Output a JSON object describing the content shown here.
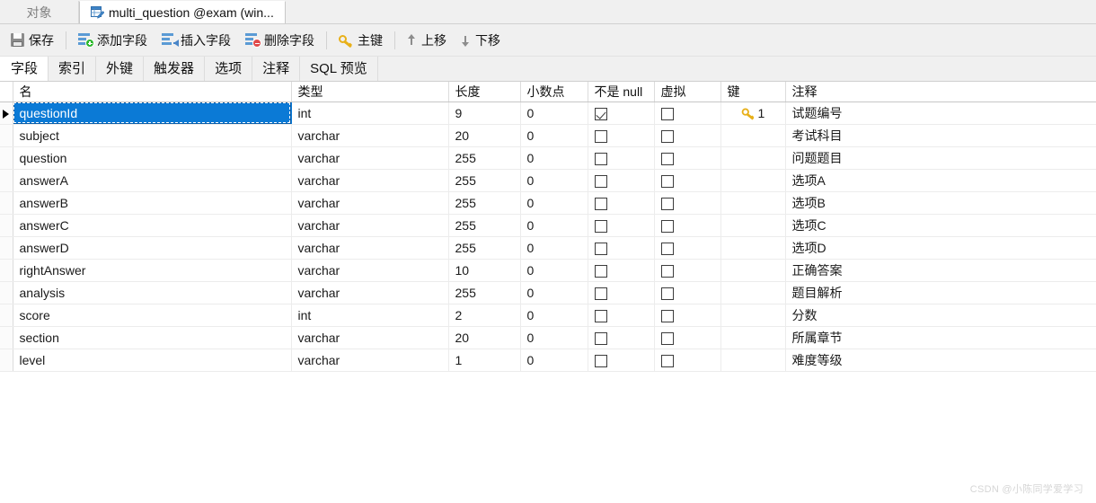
{
  "window_tabs": [
    {
      "label": "对象",
      "active": false,
      "icon": ""
    },
    {
      "label": "multi_question @exam (win...",
      "active": true,
      "icon": "table-design-icon"
    }
  ],
  "toolbar": {
    "buttons": [
      {
        "label": "保存",
        "icon": "save-icon"
      },
      {
        "label": "添加字段",
        "icon": "add-field-icon"
      },
      {
        "label": "插入字段",
        "icon": "insert-field-icon"
      },
      {
        "label": "删除字段",
        "icon": "delete-field-icon"
      },
      {
        "label": "主键",
        "icon": "primary-key-icon"
      },
      {
        "label": "上移",
        "icon": "arrow-up-icon"
      },
      {
        "label": "下移",
        "icon": "arrow-down-icon"
      }
    ]
  },
  "section_tabs": [
    {
      "label": "字段",
      "active": true
    },
    {
      "label": "索引",
      "active": false
    },
    {
      "label": "外键",
      "active": false
    },
    {
      "label": "触发器",
      "active": false
    },
    {
      "label": "选项",
      "active": false
    },
    {
      "label": "注释",
      "active": false
    },
    {
      "label": "SQL 预览",
      "active": false
    }
  ],
  "grid": {
    "columns": [
      "名",
      "类型",
      "长度",
      "小数点",
      "不是 null",
      "虚拟",
      "键",
      "注释"
    ],
    "rows": [
      {
        "name": "questionId",
        "type": "int",
        "length": "9",
        "decimals": "0",
        "not_null": true,
        "virtual": false,
        "key": "1",
        "comment": "试题编号",
        "selected": true,
        "current": true
      },
      {
        "name": "subject",
        "type": "varchar",
        "length": "20",
        "decimals": "0",
        "not_null": false,
        "virtual": false,
        "key": "",
        "comment": "考试科目",
        "selected": false,
        "current": false
      },
      {
        "name": "question",
        "type": "varchar",
        "length": "255",
        "decimals": "0",
        "not_null": false,
        "virtual": false,
        "key": "",
        "comment": "问题题目",
        "selected": false,
        "current": false
      },
      {
        "name": "answerA",
        "type": "varchar",
        "length": "255",
        "decimals": "0",
        "not_null": false,
        "virtual": false,
        "key": "",
        "comment": "选项A",
        "selected": false,
        "current": false
      },
      {
        "name": "answerB",
        "type": "varchar",
        "length": "255",
        "decimals": "0",
        "not_null": false,
        "virtual": false,
        "key": "",
        "comment": "选项B",
        "selected": false,
        "current": false
      },
      {
        "name": "answerC",
        "type": "varchar",
        "length": "255",
        "decimals": "0",
        "not_null": false,
        "virtual": false,
        "key": "",
        "comment": "选项C",
        "selected": false,
        "current": false
      },
      {
        "name": "answerD",
        "type": "varchar",
        "length": "255",
        "decimals": "0",
        "not_null": false,
        "virtual": false,
        "key": "",
        "comment": "选项D",
        "selected": false,
        "current": false
      },
      {
        "name": "rightAnswer",
        "type": "varchar",
        "length": "10",
        "decimals": "0",
        "not_null": false,
        "virtual": false,
        "key": "",
        "comment": "正确答案",
        "selected": false,
        "current": false
      },
      {
        "name": "analysis",
        "type": "varchar",
        "length": "255",
        "decimals": "0",
        "not_null": false,
        "virtual": false,
        "key": "",
        "comment": "题目解析",
        "selected": false,
        "current": false
      },
      {
        "name": "score",
        "type": "int",
        "length": "2",
        "decimals": "0",
        "not_null": false,
        "virtual": false,
        "key": "",
        "comment": "分数",
        "selected": false,
        "current": false
      },
      {
        "name": "section",
        "type": "varchar",
        "length": "20",
        "decimals": "0",
        "not_null": false,
        "virtual": false,
        "key": "",
        "comment": "所属章节",
        "selected": false,
        "current": false
      },
      {
        "name": "level",
        "type": "varchar",
        "length": "1",
        "decimals": "0",
        "not_null": false,
        "virtual": false,
        "key": "",
        "comment": "难度等级",
        "selected": false,
        "current": false
      }
    ]
  },
  "watermark": "CSDN @小陈同学爱学习"
}
